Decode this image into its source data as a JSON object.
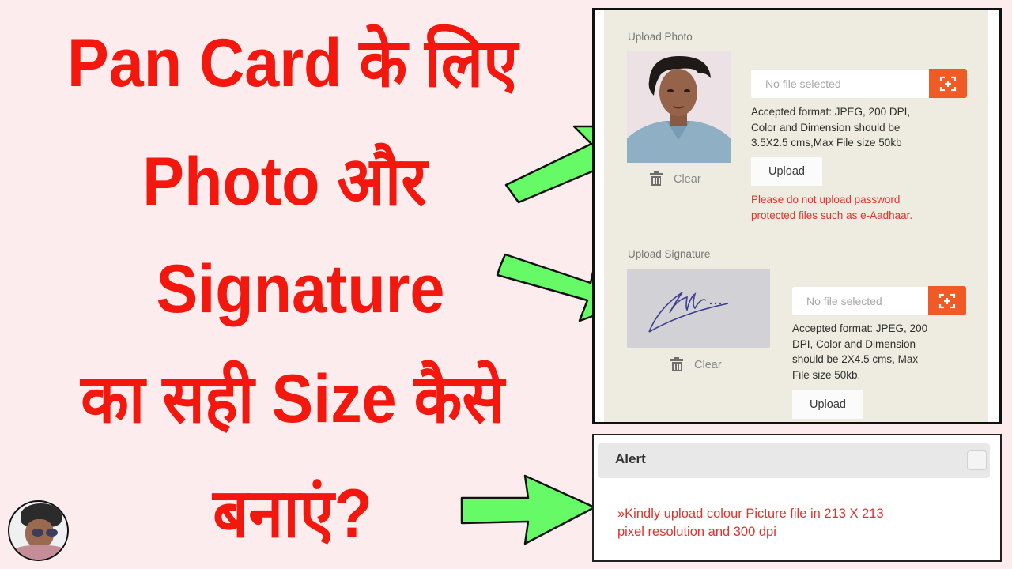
{
  "headline": {
    "line1": "Pan Card के लिए",
    "line2": "Photo और",
    "line3": "Signature",
    "line4": "का सही Size कैसे",
    "line5": "बनाएं?",
    "color": "#f3170e"
  },
  "avatar": {
    "icon": "channel-avatar"
  },
  "arrows": {
    "color": "#66fa66",
    "items": [
      "arrow-to-photo",
      "arrow-to-signature",
      "arrow-to-alert"
    ]
  },
  "photo_section": {
    "label": "Upload Photo",
    "preview_alt": "Passport photo preview",
    "clear_label": "Clear",
    "file_placeholder": "No file selected",
    "browse_icon": "add-file-icon",
    "help_line1": "Accepted format: JPEG, 200 DPI,",
    "help_line2": "Color and Dimension should be",
    "help_line3": "3.5X2.5 cms,Max File size 50kb",
    "upload_label": "Upload",
    "warning_line1": "Please do not upload password",
    "warning_line2": "protected files such as e-Aadhaar."
  },
  "signature_section": {
    "label": "Upload Signature",
    "preview_alt": "Signature preview",
    "clear_label": "Clear",
    "file_placeholder": "No file selected",
    "browse_icon": "add-file-icon",
    "help_line1": "Accepted format: JPEG, 200",
    "help_line2": "DPI, Color and Dimension",
    "help_line3": "should be 2X4.5 cms, Max",
    "help_line4": "File size 50kb.",
    "upload_label": "Upload"
  },
  "alert": {
    "title": "Alert",
    "message_line1": "»Kindly upload colour Picture file in 213 X 213",
    "message_line2": "pixel resolution and 300 dpi"
  },
  "colors": {
    "background": "#fdeced",
    "panel": "#eeece0",
    "accent_orange": "#f05a24",
    "warning_red": "#e4322b"
  }
}
